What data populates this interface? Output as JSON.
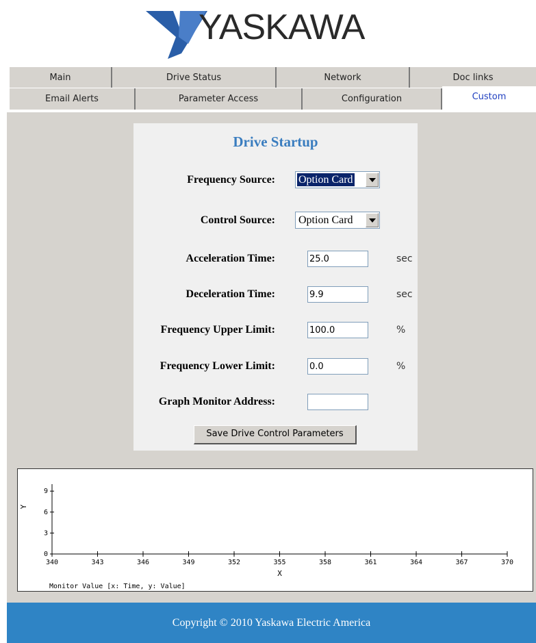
{
  "brand": {
    "name": "YASKAWA",
    "logo_color": "#2a5ea8"
  },
  "tabs": {
    "row1": [
      "Main",
      "Drive Status",
      "Network",
      "Doc links"
    ],
    "row2": [
      "Email Alerts",
      "Parameter Access",
      "Configuration",
      "Custom"
    ],
    "active": "Custom"
  },
  "panel": {
    "title": "Drive Startup",
    "fields": {
      "frequency_source": {
        "label": "Frequency Source:",
        "value": "Option Card"
      },
      "control_source": {
        "label": "Control Source:",
        "value": "Option Card"
      },
      "acceleration_time": {
        "label": "Acceleration Time:",
        "value": "25.0",
        "unit": "sec"
      },
      "deceleration_time": {
        "label": "Deceleration Time:",
        "value": "9.9",
        "unit": "sec"
      },
      "freq_upper_limit": {
        "label": "Frequency Upper Limit:",
        "value": "100.0",
        "unit": "%"
      },
      "freq_lower_limit": {
        "label": "Frequency Lower Limit:",
        "value": "0.0",
        "unit": "%"
      },
      "graph_monitor_address": {
        "label": "Graph Monitor Address:",
        "value": ""
      }
    },
    "save_button": "Save Drive Control Parameters"
  },
  "chart_data": {
    "type": "line",
    "x": [],
    "series": [],
    "xlabel": "X",
    "ylabel": "Y",
    "xticks": [
      340,
      343,
      346,
      349,
      352,
      355,
      358,
      361,
      364,
      367,
      370
    ],
    "yticks": [
      0,
      3,
      6,
      9
    ],
    "xlim": [
      340,
      370
    ],
    "ylim": [
      0,
      10
    ],
    "caption": "Monitor Value [x: Time, y: Value]",
    "grid": false
  },
  "footer": {
    "copyright": "Copyright © 2010 Yaskawa Electric America"
  },
  "colors": {
    "accent": "#3a7dbf",
    "footer_bg": "#2f84c5",
    "active_tab_text": "#2040c0",
    "bg": "#d6d3ce"
  }
}
